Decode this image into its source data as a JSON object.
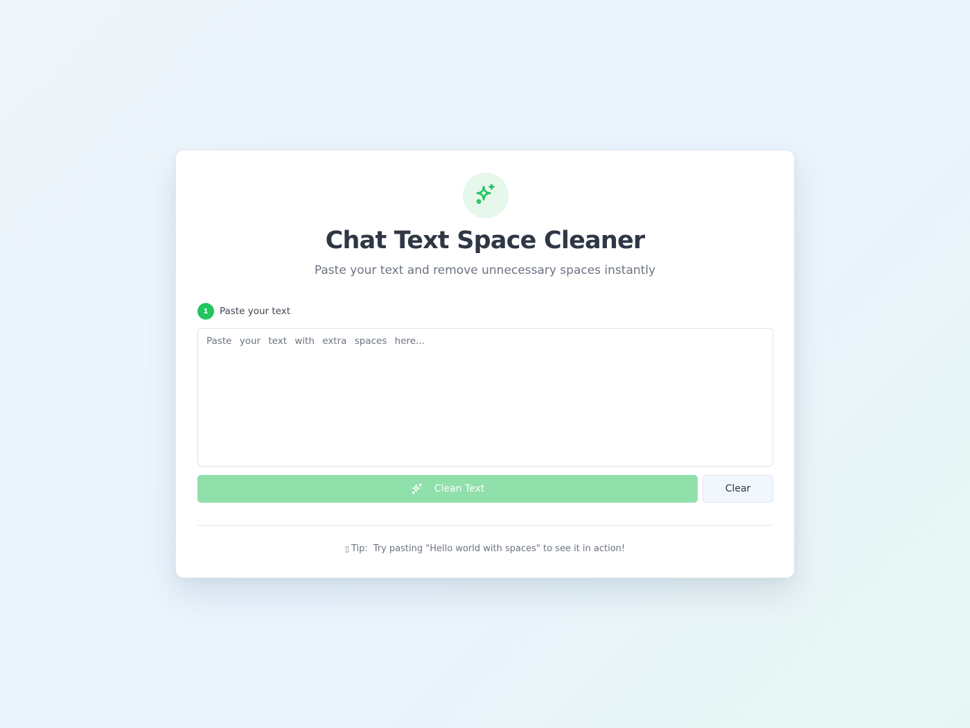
{
  "header": {
    "logo_icon": "sparkles-icon",
    "title": "Chat Text Space Cleaner",
    "subtitle": "Paste your text and remove unnecessary spaces instantly"
  },
  "step": {
    "number": "1",
    "label": "Paste your text"
  },
  "input": {
    "value": "",
    "placeholder": "Paste your text with extra spaces here..."
  },
  "actions": {
    "clean_label": "Clean Text",
    "clean_icon": "sparkles-icon",
    "clear_label": "Clear"
  },
  "tip": {
    "icon": "lightbulb-icon",
    "prefix": "Tip:",
    "text": "Try pasting \"Hello world with spaces\" to see it in action!"
  },
  "colors": {
    "accent": "#22c55e",
    "accent_light": "#e6f7ec",
    "clean_button_bg": "#8fe0aa",
    "title": "#2f3745",
    "muted": "#6b7280"
  }
}
